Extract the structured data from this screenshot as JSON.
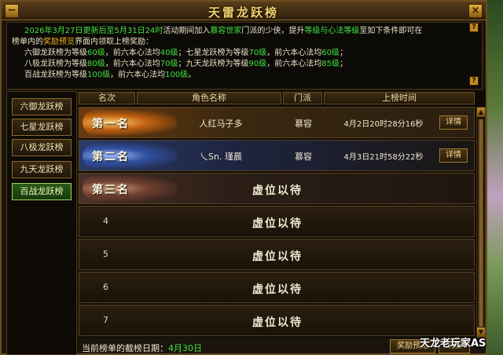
{
  "window": {
    "title": "天雷龙跃榜",
    "close_label": "×",
    "min_label": "−"
  },
  "info": {
    "p1_a": "2026年3月27日更新后至5月31日24时",
    "p1_b": "活动期间加入",
    "p1_c": "慕容世家",
    "p1_d": "门派的少侠，提升",
    "p1_e": "等级与心法等级",
    "p1_f": "至如下条件即可在",
    "p2_a": "榜单内的",
    "p2_b": "奖励预览",
    "p2_c": "界面内领取上榜奖励：",
    "r1a": "六御龙跃榜为等级",
    "r1a_v": "60级",
    "r1b": "，前六本心法均",
    "r1b_v": "40级",
    "r1c": "；七星龙跃榜为等级",
    "r1c_v": "70级",
    "r1d": "，前六本心法均",
    "r1d_v": "60级",
    "r1e": "；",
    "r2a": "八极龙跃榜为等级",
    "r2a_v": "80级",
    "r2b": "，前六本心法均",
    "r2b_v": "70级",
    "r2c": "；九天龙跃榜为等级",
    "r2c_v": "90级",
    "r2d": "，前六本心法均",
    "r2d_v": "85级",
    "r2e": "；",
    "r3a": "百战龙跃榜为等级",
    "r3a_v": "100级",
    "r3b": "，前六本心法均",
    "r3b_v": "100级",
    "r3c": "。",
    "help": "?"
  },
  "sidebar": {
    "tabs": [
      "六御龙跃榜",
      "七星龙跃榜",
      "八极龙跃榜",
      "九天龙跃榜",
      "百战龙跃榜"
    ],
    "active": 4
  },
  "table": {
    "headers": [
      "名次",
      "角色名称",
      "门派",
      "上榜时间"
    ],
    "rows": [
      {
        "rank": "第一名",
        "name": "人红马子多",
        "sect": "慕容",
        "time": "4月2日20时28分16秒",
        "detail": "详情"
      },
      {
        "rank": "第二名",
        "name": "乀Sn. 瑾晨",
        "sect": "慕容",
        "time": "4月3日21时58分22秒",
        "detail": "详情"
      },
      {
        "rank": "第三名",
        "vacant": "虚位以待"
      },
      {
        "rank": "4",
        "vacant": "虚位以待"
      },
      {
        "rank": "5",
        "vacant": "虚位以待"
      },
      {
        "rank": "6",
        "vacant": "虚位以待"
      },
      {
        "rank": "7",
        "vacant": "虚位以待"
      }
    ]
  },
  "footer": {
    "deadline_label": "当前榜单的截榜日期：",
    "deadline_value": "4月30日",
    "preview_btn": "奖励预览",
    "refresh_btn": "刷新"
  },
  "watermark": "天龙老玩家AS"
}
